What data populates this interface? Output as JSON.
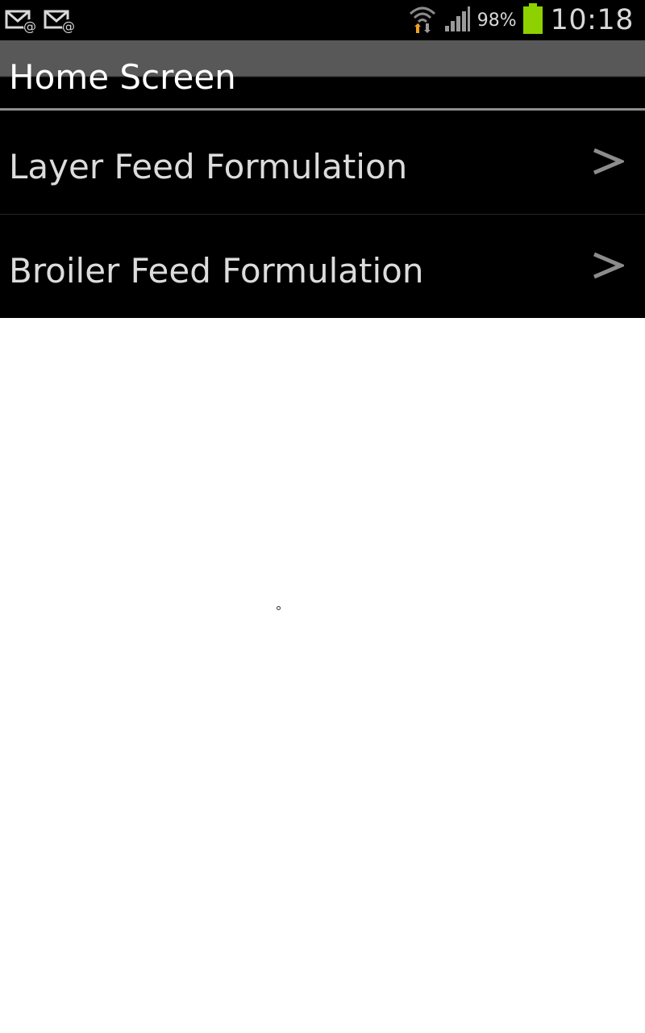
{
  "status_bar": {
    "notification_icons": [
      "email-notification-icon",
      "email-notification-icon"
    ],
    "wifi_icon": "wifi-icon",
    "signal_icon": "cell-signal-icon",
    "battery_icon": "battery-icon",
    "battery_percent": "98%",
    "time": "10:18",
    "colors": {
      "background": "#000000",
      "text": "#d8d8d8",
      "battery": "#8ed000",
      "wifi_arrows": "#f0a020"
    }
  },
  "header": {
    "title": "Home Screen"
  },
  "menu": {
    "items": [
      {
        "label": "Layer Feed Formulation",
        "icon": "chevron-right-icon"
      },
      {
        "label": "Broiler Feed Formulation",
        "icon": "chevron-right-icon"
      }
    ]
  },
  "theme": {
    "title_bar_top": "#585858",
    "list_background": "#000000",
    "list_text": "#dcdcdc",
    "page_background": "#ffffff"
  }
}
